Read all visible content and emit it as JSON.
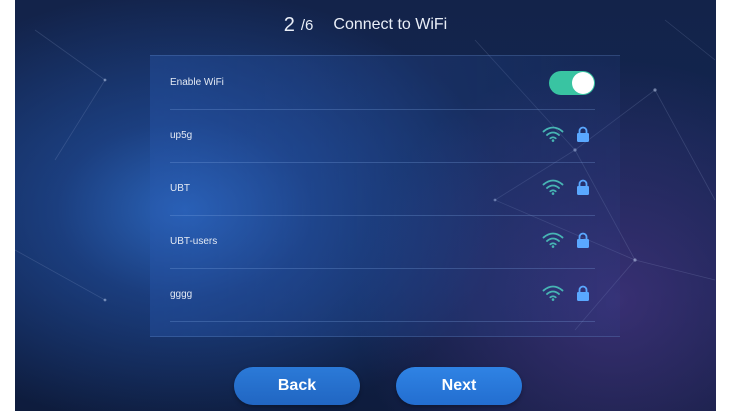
{
  "header": {
    "step_current": "2",
    "step_total": "/6",
    "title": "Connect to WiFi"
  },
  "enable_wifi": {
    "label": "Enable WiFi",
    "enabled": true
  },
  "networks": [
    {
      "ssid": "up5g",
      "icons": [
        "wifi-icon",
        "lock-icon"
      ]
    },
    {
      "ssid": "UBT",
      "icons": [
        "wifi-icon",
        "lock-icon"
      ]
    },
    {
      "ssid": "UBT-users",
      "icons": [
        "wifi-icon",
        "lock-icon"
      ]
    },
    {
      "ssid": "gggg",
      "icons": [
        "wifi-icon",
        "lock-icon"
      ]
    }
  ],
  "buttons": {
    "back": "Back",
    "next": "Next"
  },
  "colors": {
    "accent": "#2a74d6",
    "toggle_on": "#39c4a2",
    "wifi": "#47b5b4",
    "lock": "#5aa8ff"
  }
}
